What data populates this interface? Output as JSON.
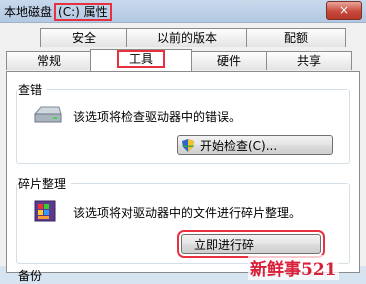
{
  "window": {
    "title_prefix": "本地磁盘",
    "title_highlight": "(C:) 属性",
    "close_label": "×"
  },
  "tabs_row1": [
    "安全",
    "以前的版本",
    "配额"
  ],
  "tabs_row2": [
    "常规",
    "工具",
    "硬件",
    "共享"
  ],
  "active_tab": "工具",
  "error_check": {
    "group_title": "查错",
    "description": "该选项将检查驱动器中的错误。",
    "button_label": "开始检查(C)..."
  },
  "defrag": {
    "group_title": "碎片整理",
    "description": "该选项将对驱动器中的文件进行碎片整理。",
    "button_label": "立即进行碎"
  },
  "backup": {
    "group_title": "备份"
  },
  "watermark": "新鲜事521"
}
